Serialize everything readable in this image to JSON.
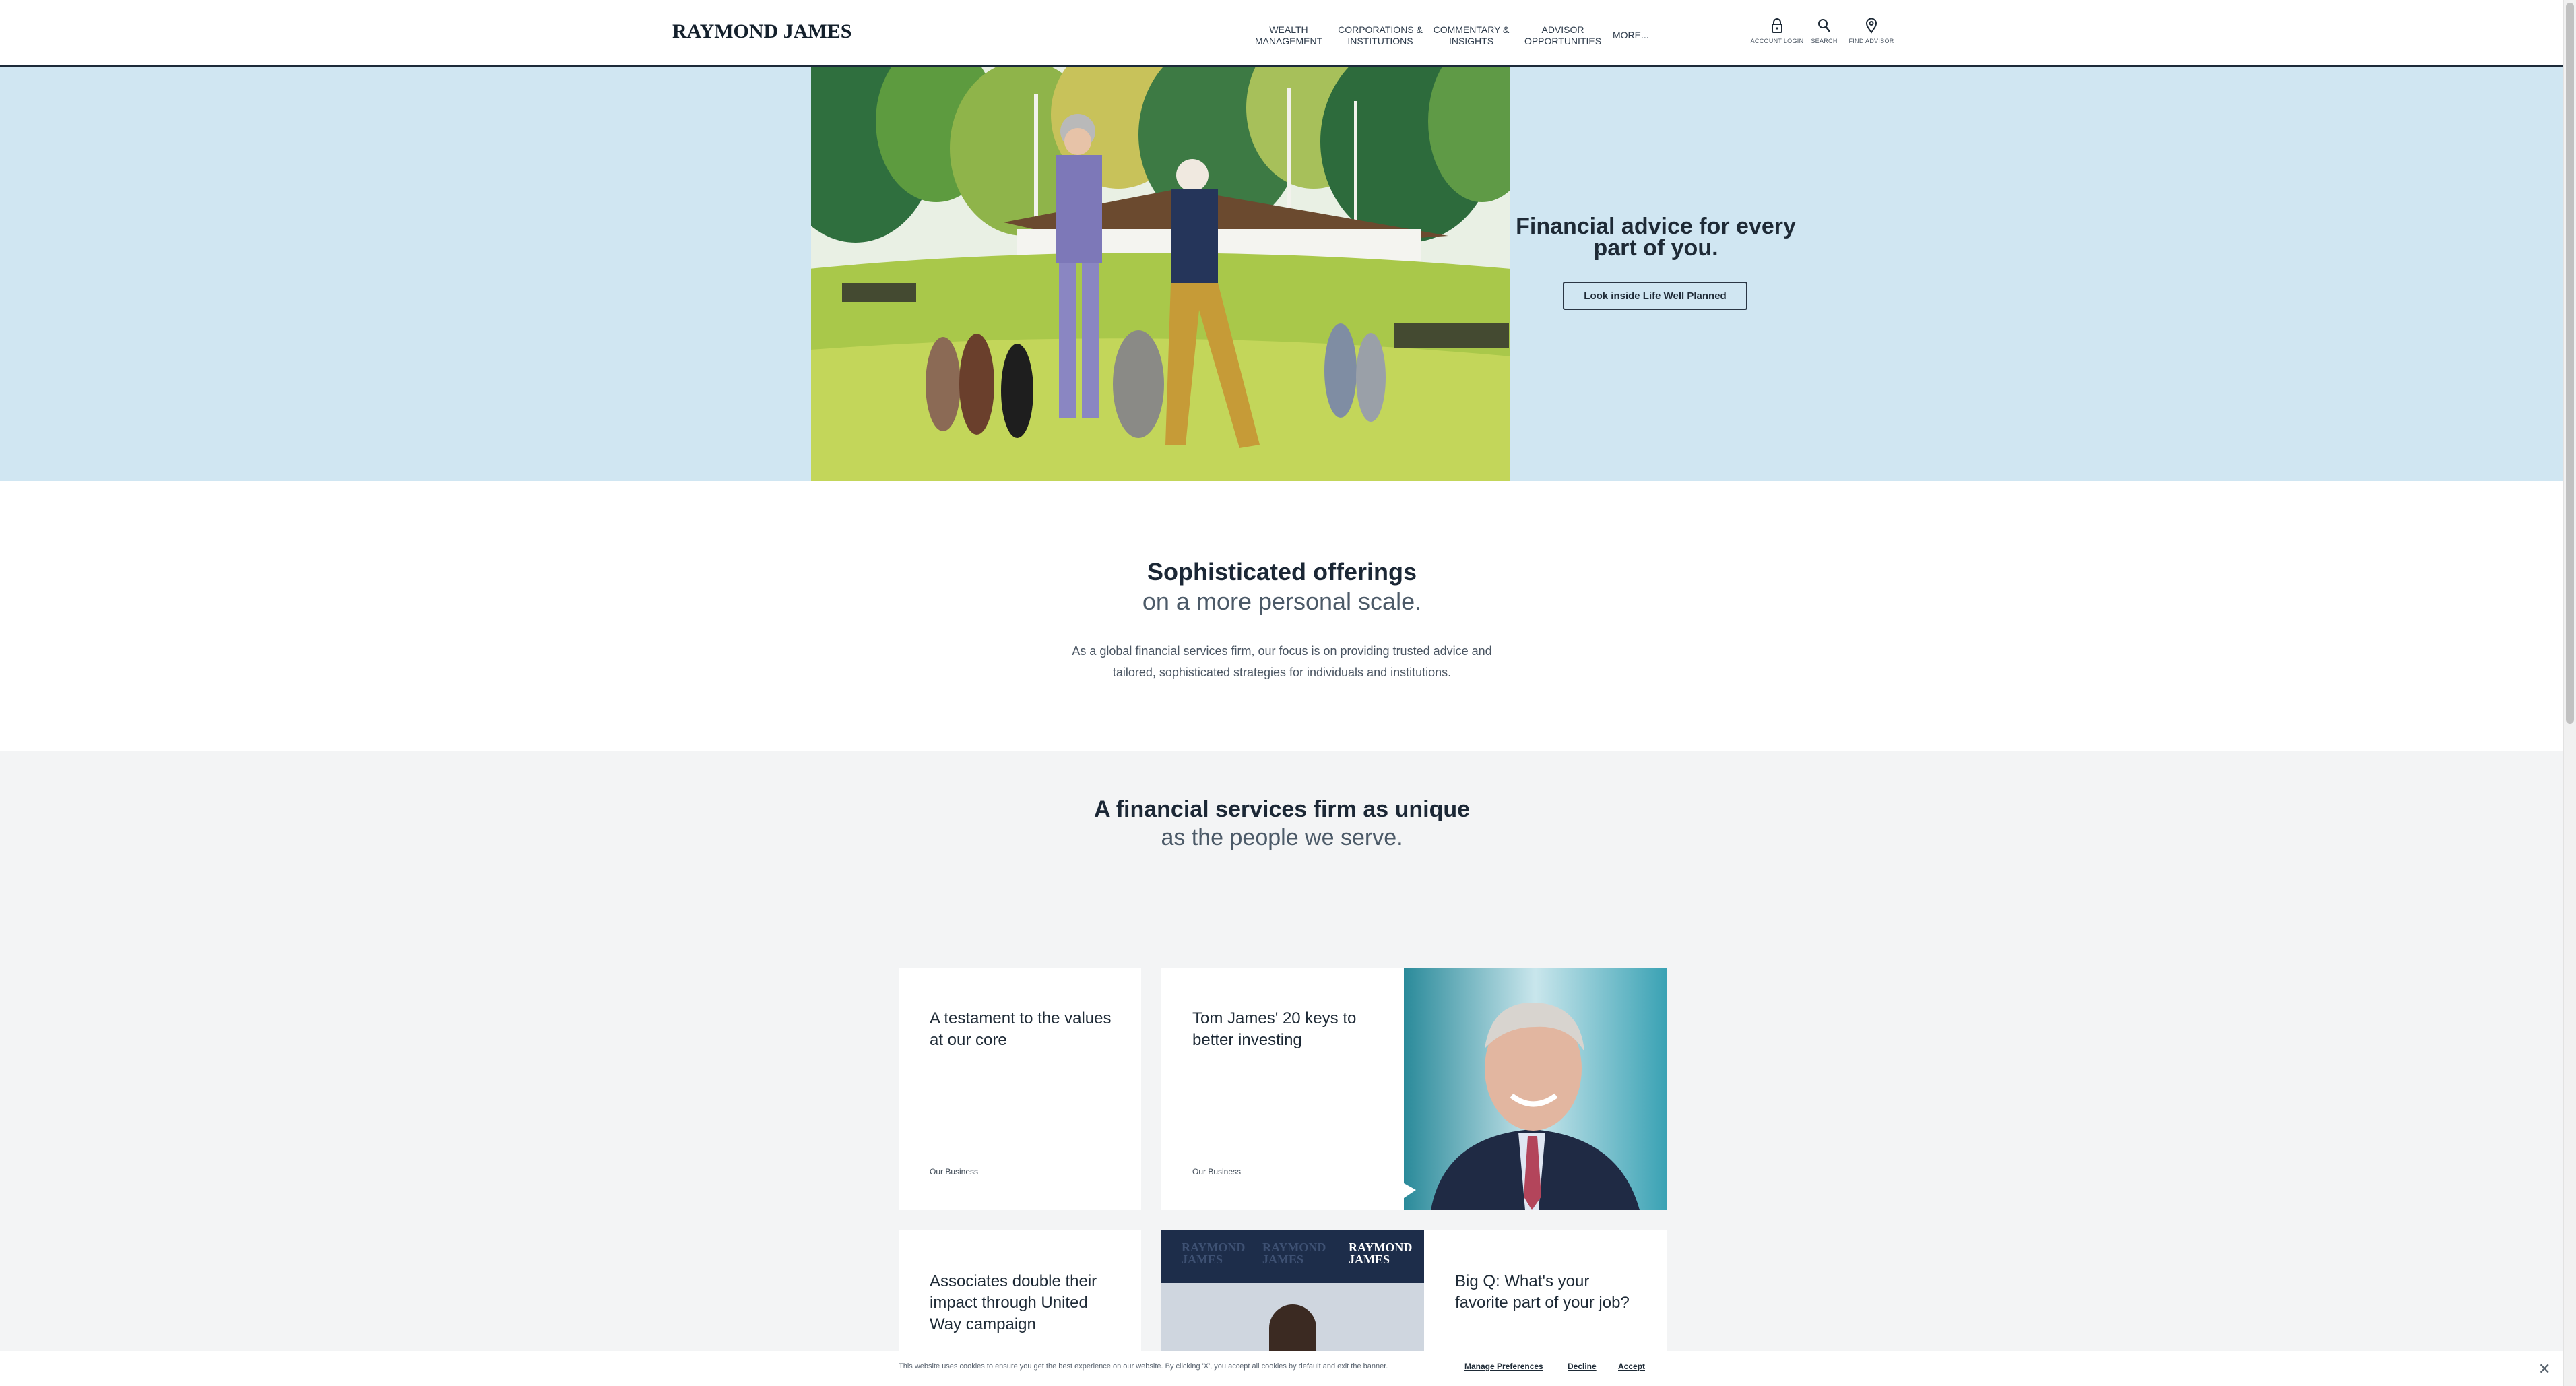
{
  "header": {
    "logo": "RAYMOND JAMES",
    "nav": [
      {
        "label": "WEALTH\nMANAGEMENT"
      },
      {
        "label": "CORPORATIONS &\nINSTITUTIONS"
      },
      {
        "label": "COMMENTARY &\nINSIGHTS"
      },
      {
        "label": "ADVISOR\nOPPORTUNITIES"
      },
      {
        "label": "MORE..."
      }
    ],
    "utilities": {
      "account": {
        "label": "ACCOUNT LOGIN",
        "icon": "lock-icon"
      },
      "search": {
        "label": "SEARCH",
        "icon": "search-icon"
      },
      "advisor": {
        "label": "FIND ADVISOR",
        "icon": "map-pin-icon"
      }
    }
  },
  "hero": {
    "title": "Financial advice for every part of you.",
    "button": "Look inside Life Well Planned"
  },
  "offerings": {
    "title": "Sophisticated offerings",
    "subtitle": "on a more personal scale.",
    "body": "As a global financial services firm, our focus is on providing trusted advice and tailored, sophisticated strategies for individuals and institutions."
  },
  "firm": {
    "title": "A financial services firm as unique",
    "subtitle": "as the people we serve."
  },
  "cards": [
    {
      "title": "A testament to the values at our core",
      "category": "Our Business"
    },
    {
      "title": "Tom James' 20 keys to better investing",
      "category": "Our Business"
    },
    {
      "title": "Associates double their impact through United Way campaign"
    },
    {
      "title": "Big Q: What's your favorite part of your job?"
    }
  ],
  "video_logos": [
    "RAYMOND JAMES",
    "RAYMOND JAMES",
    "RAYMOND JAMES"
  ],
  "cookie": {
    "text": "This website uses cookies to ensure you get the best experience on our website. By clicking 'X', you accept all cookies by default and exit the banner.",
    "manage": "Manage Preferences",
    "decline": "Decline",
    "accept": "Accept"
  }
}
